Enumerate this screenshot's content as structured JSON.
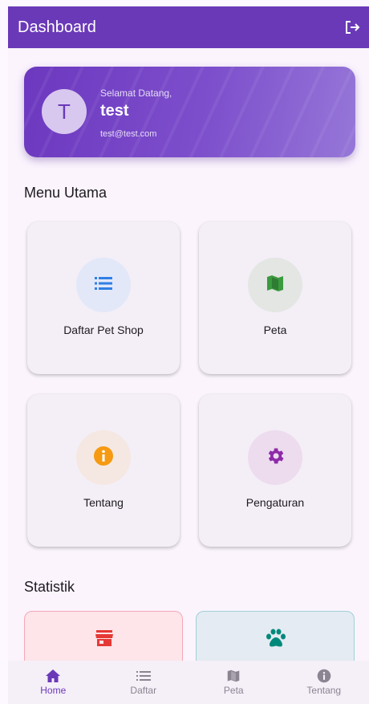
{
  "appbar": {
    "title": "Dashboard"
  },
  "welcome": {
    "avatar_initial": "T",
    "greeting": "Selamat Datang,",
    "name": "test",
    "email": "test@test.com"
  },
  "menu": {
    "title": "Menu Utama",
    "items": [
      {
        "label": "Daftar Pet Shop",
        "icon": "list-icon",
        "color": "#2f7fe6",
        "bg": "#e2e8f8"
      },
      {
        "label": "Peta",
        "icon": "map-icon",
        "color": "#3a9a3e",
        "bg": "#e3e6e3"
      },
      {
        "label": "Tentang",
        "icon": "info-icon",
        "color": "#f59a12",
        "bg": "#f5e8e2"
      },
      {
        "label": "Pengaturan",
        "icon": "gear-icon",
        "color": "#8e2aa8",
        "bg": "#ecdcee"
      }
    ]
  },
  "stats": {
    "title": "Statistik",
    "cards": [
      {
        "icon": "store-icon",
        "color": "#e53935",
        "bg": "#fde5ea",
        "border": "#f3a9b6"
      },
      {
        "icon": "paw-icon",
        "color": "#00897b",
        "bg": "#e4ebf2",
        "border": "#9fd1d6"
      }
    ]
  },
  "nav": {
    "items": [
      {
        "label": "Home",
        "icon": "home-icon",
        "active": true
      },
      {
        "label": "Daftar",
        "icon": "list-icon",
        "active": false
      },
      {
        "label": "Peta",
        "icon": "map-icon",
        "active": false
      },
      {
        "label": "Tentang",
        "icon": "info-icon",
        "active": false
      }
    ]
  }
}
